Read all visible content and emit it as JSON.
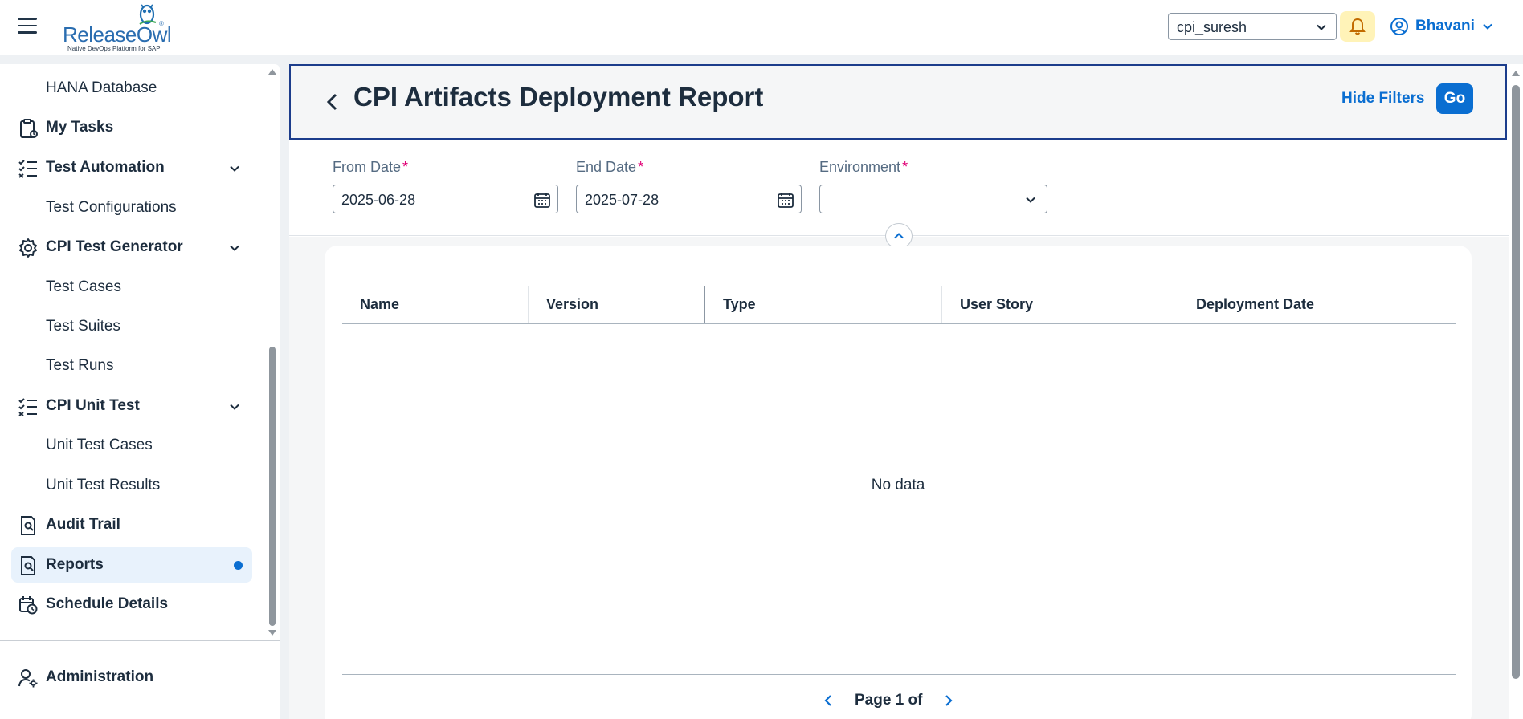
{
  "app": {
    "logo_name": "ReleaseOwl",
    "logo_tagline": "Native DevOps Platform for SAP",
    "logo_reg": "®"
  },
  "header": {
    "tenant_select_value": "cpi_suresh",
    "user_name": "Bhavani",
    "icons": {
      "menu": "hamburger-icon",
      "notifications": "bell-icon",
      "profile": "user-circle-icon"
    },
    "accent_color": "#0a6ed1",
    "bell_bg_color": "#fff3b8"
  },
  "sidebar": {
    "items": [
      {
        "label": "HANA Database",
        "type": "sub"
      },
      {
        "label": "My Tasks",
        "type": "group",
        "icon": "clipboard-tasks-icon"
      },
      {
        "label": "Test Automation",
        "type": "group",
        "icon": "checklist-icon",
        "expanded": true
      },
      {
        "label": "Test Configurations",
        "type": "sub"
      },
      {
        "label": "CPI Test Generator",
        "type": "group",
        "icon": "gear-icon",
        "expanded": true
      },
      {
        "label": "Test Cases",
        "type": "sub"
      },
      {
        "label": "Test Suites",
        "type": "sub"
      },
      {
        "label": "Test Runs",
        "type": "sub"
      },
      {
        "label": "CPI Unit Test",
        "type": "group",
        "icon": "checklist-icon",
        "expanded": true
      },
      {
        "label": "Unit Test Cases",
        "type": "sub"
      },
      {
        "label": "Unit Test Results",
        "type": "sub"
      },
      {
        "label": "Audit Trail",
        "type": "group",
        "icon": "document-search-icon"
      },
      {
        "label": "Reports",
        "type": "group",
        "icon": "document-search-icon",
        "selected": true
      },
      {
        "label": "Schedule Details",
        "type": "group",
        "icon": "calendar-clock-icon"
      }
    ],
    "footer_item": {
      "label": "Administration",
      "icon": "user-settings-icon"
    }
  },
  "page": {
    "title": "CPI Artifacts Deployment Report",
    "hide_filters_label": "Hide Filters",
    "go_label": "Go"
  },
  "filters": {
    "from_date": {
      "label": "From Date",
      "required_mark": "*",
      "value": "2025-06-28"
    },
    "end_date": {
      "label": "End Date",
      "required_mark": "*",
      "value": "2025-07-28"
    },
    "environment": {
      "label": "Environment",
      "required_mark": "*",
      "value": ""
    }
  },
  "table": {
    "columns": [
      "Name",
      "Version",
      "Type",
      "User Story",
      "Deployment Date"
    ],
    "rows": [],
    "empty_text": "No data"
  },
  "pagination": {
    "text": "Page 1 of"
  }
}
